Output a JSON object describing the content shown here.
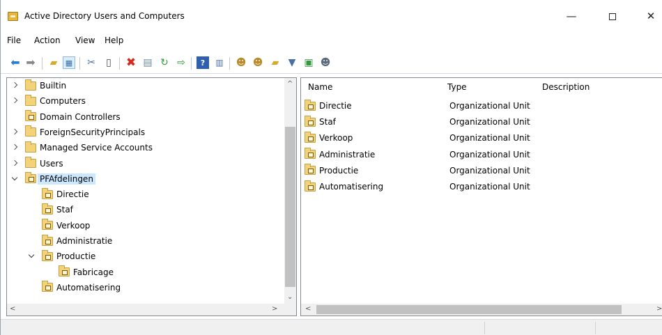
{
  "window": {
    "title": "Active Directory Users and Computers",
    "controls": {
      "minimize": "—",
      "maximize": "",
      "close": "✕"
    }
  },
  "menu": [
    "File",
    "Action",
    "View",
    "Help"
  ],
  "toolbar": {
    "icons": [
      "back-arrow-icon",
      "forward-arrow-icon",
      "up-folder-icon",
      "show-tree-icon",
      "cut-icon",
      "copy-icon",
      "delete-icon",
      "properties-icon",
      "refresh-icon",
      "export-list-icon",
      "help-icon",
      "details-view-icon",
      "new-user-icon",
      "new-group-icon",
      "new-ou-icon",
      "filter-icon",
      "add-to-group-icon",
      "delegate-icon"
    ]
  },
  "tree": {
    "items": [
      {
        "label": "Builtin",
        "expander": "closed",
        "ou": false,
        "indent": 0
      },
      {
        "label": "Computers",
        "expander": "closed",
        "ou": false,
        "indent": 0
      },
      {
        "label": "Domain Controllers",
        "expander": "none",
        "ou": true,
        "indent": 0
      },
      {
        "label": "ForeignSecurityPrincipals",
        "expander": "closed",
        "ou": false,
        "indent": 0
      },
      {
        "label": "Managed Service Accounts",
        "expander": "closed",
        "ou": false,
        "indent": 0
      },
      {
        "label": "Users",
        "expander": "closed",
        "ou": false,
        "indent": 0
      },
      {
        "label": "PFAfdelingen",
        "expander": "open",
        "ou": true,
        "indent": 0,
        "selected": true
      },
      {
        "label": "Directie",
        "expander": "none",
        "ou": true,
        "indent": 1
      },
      {
        "label": "Staf",
        "expander": "none",
        "ou": true,
        "indent": 1
      },
      {
        "label": "Verkoop",
        "expander": "none",
        "ou": true,
        "indent": 1
      },
      {
        "label": "Administratie",
        "expander": "none",
        "ou": true,
        "indent": 1
      },
      {
        "label": "Productie",
        "expander": "open",
        "ou": true,
        "indent": 1
      },
      {
        "label": "Fabricage",
        "expander": "none",
        "ou": true,
        "indent": 2
      },
      {
        "label": "Automatisering",
        "expander": "none",
        "ou": true,
        "indent": 1
      }
    ]
  },
  "list": {
    "columns": [
      "Name",
      "Type",
      "Description"
    ],
    "rows": [
      {
        "name": "Directie",
        "type": "Organizational Unit",
        "description": ""
      },
      {
        "name": "Staf",
        "type": "Organizational Unit",
        "description": ""
      },
      {
        "name": "Verkoop",
        "type": "Organizational Unit",
        "description": ""
      },
      {
        "name": "Administratie",
        "type": "Organizational Unit",
        "description": ""
      },
      {
        "name": "Productie",
        "type": "Organizational Unit",
        "description": ""
      },
      {
        "name": "Automatisering",
        "type": "Organizational Unit",
        "description": ""
      }
    ]
  },
  "scroll_arrows": {
    "up": "^",
    "down": "⌄",
    "left": "<",
    "right": ">"
  },
  "colors": {
    "selection": "#cce8ff",
    "folder": "#f3d37a",
    "scroll_thumb": "#c1c1c1"
  }
}
